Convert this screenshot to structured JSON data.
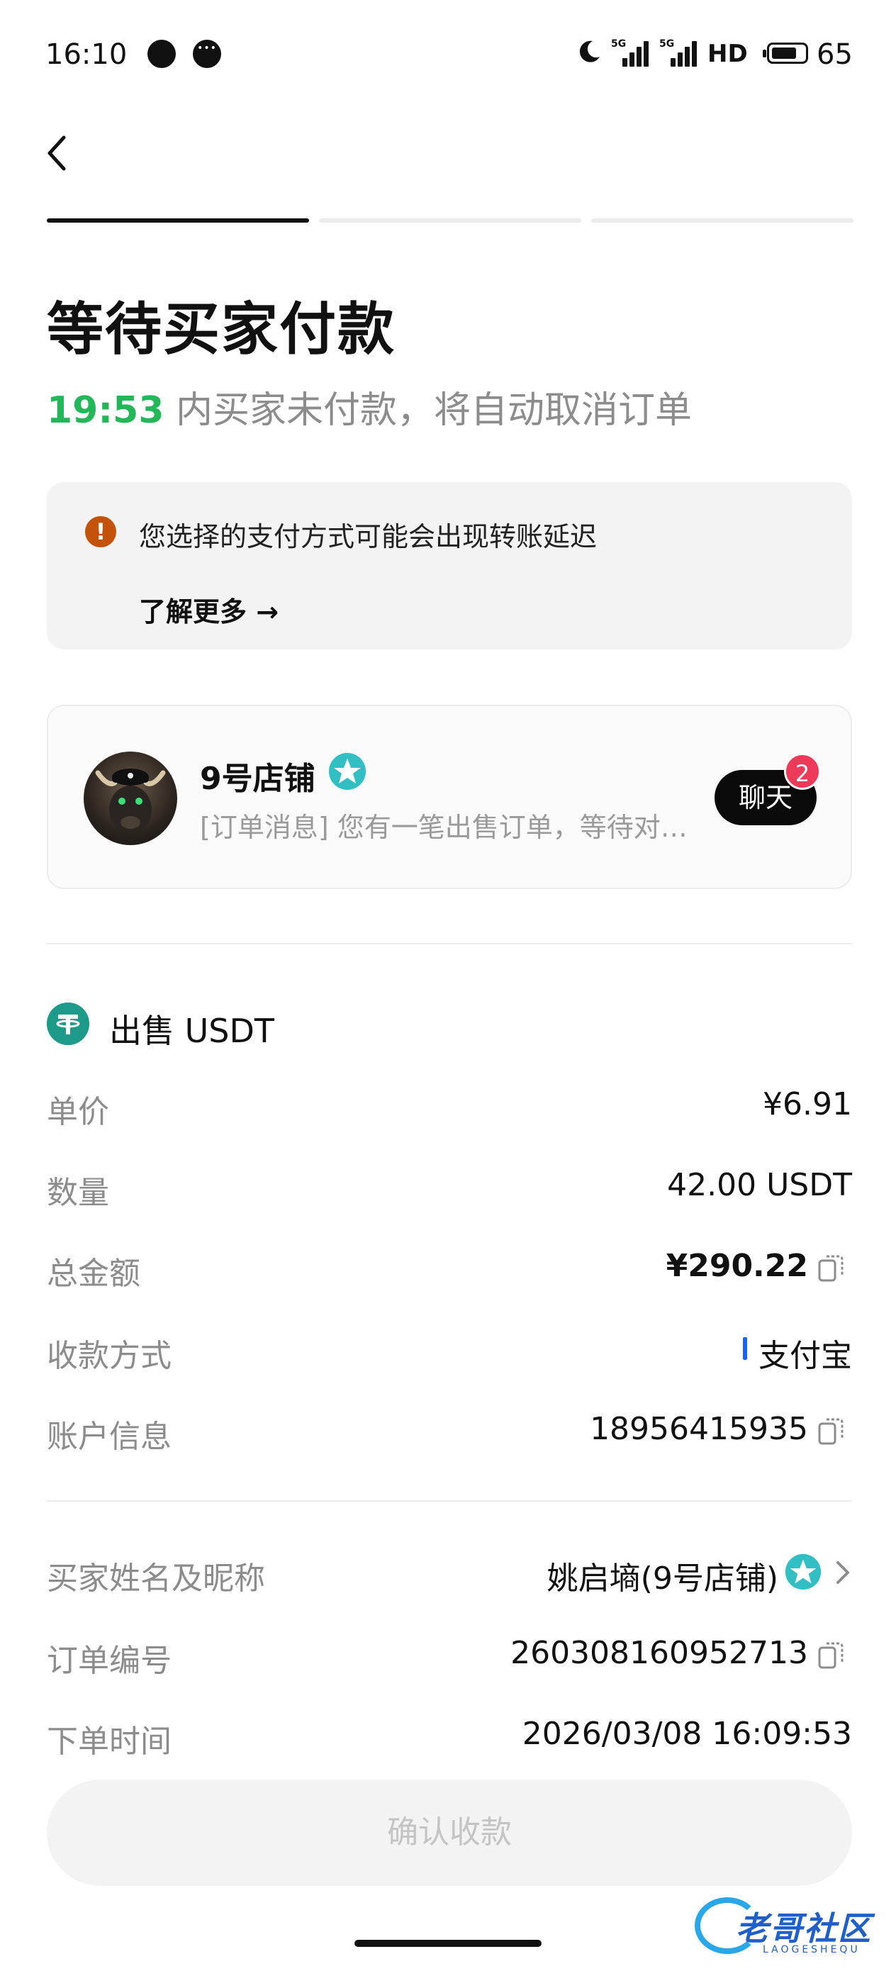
{
  "status_bar": {
    "time": "16:10",
    "net1": "5G",
    "net2": "5G",
    "hd": "HD",
    "battery": "65"
  },
  "steps": {
    "total": 3,
    "current": 1
  },
  "header": {
    "title": "等待买家付款",
    "countdown": "19:53",
    "countdown_suffix": " 内买家未付款，将自动取消订单"
  },
  "notice": {
    "text": "您选择的支付方式可能会出现转账延迟",
    "link": "了解更多 →"
  },
  "chat": {
    "store_name": "9号店铺",
    "message": "[订单消息] 您有一笔出售订单，等待对方付款",
    "button": "聊天",
    "badge": "2"
  },
  "order": {
    "heading": "出售 USDT",
    "rows": [
      {
        "label": "单价",
        "value": "¥6.91"
      },
      {
        "label": "数量",
        "value": "42.00 USDT"
      },
      {
        "label": "总金额",
        "value": "¥290.22"
      },
      {
        "label": "收款方式",
        "value": "支付宝"
      },
      {
        "label": "账户信息",
        "value": "18956415935"
      }
    ],
    "rows2": [
      {
        "label": "买家姓名及昵称",
        "value": "姚启墒(9号店铺)"
      },
      {
        "label": "订单编号",
        "value": "260308160952713"
      },
      {
        "label": "下单时间",
        "value": "2026/03/08 16:09:53"
      }
    ]
  },
  "confirm_button": "确认收款",
  "watermark": {
    "text": "老哥社区",
    "sub": "LAOGESHEQU"
  },
  "colors": {
    "countdown": "#22b85a",
    "warning": "#c4520b",
    "badge": "#ee3a5a",
    "usdt": "#1d9a8a",
    "alipay": "#1b64f3"
  }
}
